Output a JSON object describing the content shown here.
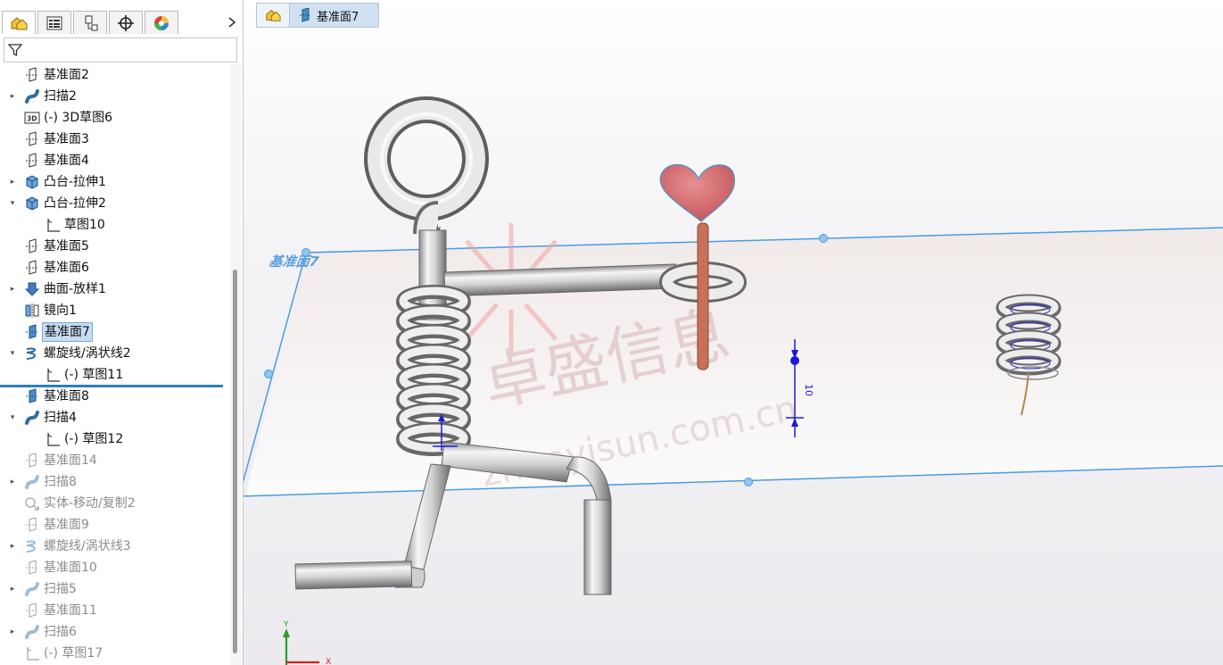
{
  "tabs": [
    {
      "name": "feature-manager-tab",
      "icon": "feature-manager-icon",
      "active": true
    },
    {
      "name": "property-manager-tab",
      "icon": "property-manager-icon",
      "active": false
    },
    {
      "name": "configuration-manager-tab",
      "icon": "configuration-manager-icon",
      "active": false
    },
    {
      "name": "dimxpert-tab",
      "icon": "dimxpert-icon",
      "active": false
    },
    {
      "name": "display-manager-tab",
      "icon": "display-manager-icon",
      "active": false
    }
  ],
  "tree": [
    {
      "label": "基准面2",
      "icon": "plane",
      "caret": false,
      "indent": 0,
      "state": "normal"
    },
    {
      "label": "扫描2",
      "icon": "sweep",
      "caret": true,
      "indent": 0,
      "state": "normal"
    },
    {
      "label": "(-) 3D草图6",
      "icon": "sketch3d",
      "caret": false,
      "indent": 0,
      "state": "normal"
    },
    {
      "label": "基准面3",
      "icon": "plane",
      "caret": false,
      "indent": 0,
      "state": "normal"
    },
    {
      "label": "基准面4",
      "icon": "plane",
      "caret": false,
      "indent": 0,
      "state": "normal"
    },
    {
      "label": "凸台-拉伸1",
      "icon": "extrude",
      "caret": true,
      "indent": 0,
      "state": "normal"
    },
    {
      "label": "凸台-拉伸2",
      "icon": "extrude",
      "caret": "open",
      "indent": 0,
      "state": "normal"
    },
    {
      "label": "草图10",
      "icon": "sketch",
      "caret": false,
      "indent": 1,
      "state": "normal"
    },
    {
      "label": "基准面5",
      "icon": "plane",
      "caret": false,
      "indent": 0,
      "state": "normal"
    },
    {
      "label": "基准面6",
      "icon": "plane",
      "caret": false,
      "indent": 0,
      "state": "normal"
    },
    {
      "label": "曲面-放样1",
      "icon": "loft",
      "caret": true,
      "indent": 0,
      "state": "normal"
    },
    {
      "label": "镜向1",
      "icon": "mirror",
      "caret": false,
      "indent": 0,
      "state": "normal"
    },
    {
      "label": "基准面7",
      "icon": "plane-blue",
      "caret": false,
      "indent": 0,
      "state": "selected"
    },
    {
      "label": "螺旋线/涡状线2",
      "icon": "helix",
      "caret": "open",
      "indent": 0,
      "state": "normal"
    },
    {
      "label": "(-) 草图11",
      "icon": "sketch",
      "caret": false,
      "indent": 1,
      "state": "normal"
    },
    {
      "label": "基准面8",
      "icon": "plane-blue",
      "caret": false,
      "indent": 0,
      "state": "normal"
    },
    {
      "label": "扫描4",
      "icon": "sweep",
      "caret": "open",
      "indent": 0,
      "state": "normal"
    },
    {
      "label": "(-) 草图12",
      "icon": "sketch",
      "caret": false,
      "indent": 1,
      "state": "normal"
    },
    {
      "label": "基准面14",
      "icon": "plane",
      "caret": false,
      "indent": 0,
      "state": "dim"
    },
    {
      "label": "扫描8",
      "icon": "sweep",
      "caret": true,
      "indent": 0,
      "state": "dim"
    },
    {
      "label": "实体-移动/复制2",
      "icon": "move",
      "caret": false,
      "indent": 0,
      "state": "dim"
    },
    {
      "label": "基准面9",
      "icon": "plane",
      "caret": false,
      "indent": 0,
      "state": "dim"
    },
    {
      "label": "螺旋线/涡状线3",
      "icon": "helix",
      "caret": true,
      "indent": 0,
      "state": "dim"
    },
    {
      "label": "基准面10",
      "icon": "plane",
      "caret": false,
      "indent": 0,
      "state": "dim"
    },
    {
      "label": "扫描5",
      "icon": "sweep",
      "caret": true,
      "indent": 0,
      "state": "dim"
    },
    {
      "label": "基准面11",
      "icon": "plane",
      "caret": false,
      "indent": 0,
      "state": "dim"
    },
    {
      "label": "扫描6",
      "icon": "sweep",
      "caret": true,
      "indent": 0,
      "state": "dim"
    },
    {
      "label": "(-) 草图17",
      "icon": "sketch",
      "caret": false,
      "indent": 0,
      "state": "dim"
    }
  ],
  "breadcrumb": {
    "label": "基准面7"
  },
  "viewport": {
    "plane_label": "基准面7",
    "dimension_value": "10",
    "axis_y": "Y",
    "axis_x": "X",
    "watermark_cn": "卓盛信息",
    "watermark_url": "zhuoyisun.com.cn"
  },
  "colors": {
    "accent": "#2c7fbd",
    "plane_edge": "#4a9de0",
    "heart": "#d46a6e",
    "stick": "#c87058",
    "dim_blue": "#1a1adf"
  }
}
